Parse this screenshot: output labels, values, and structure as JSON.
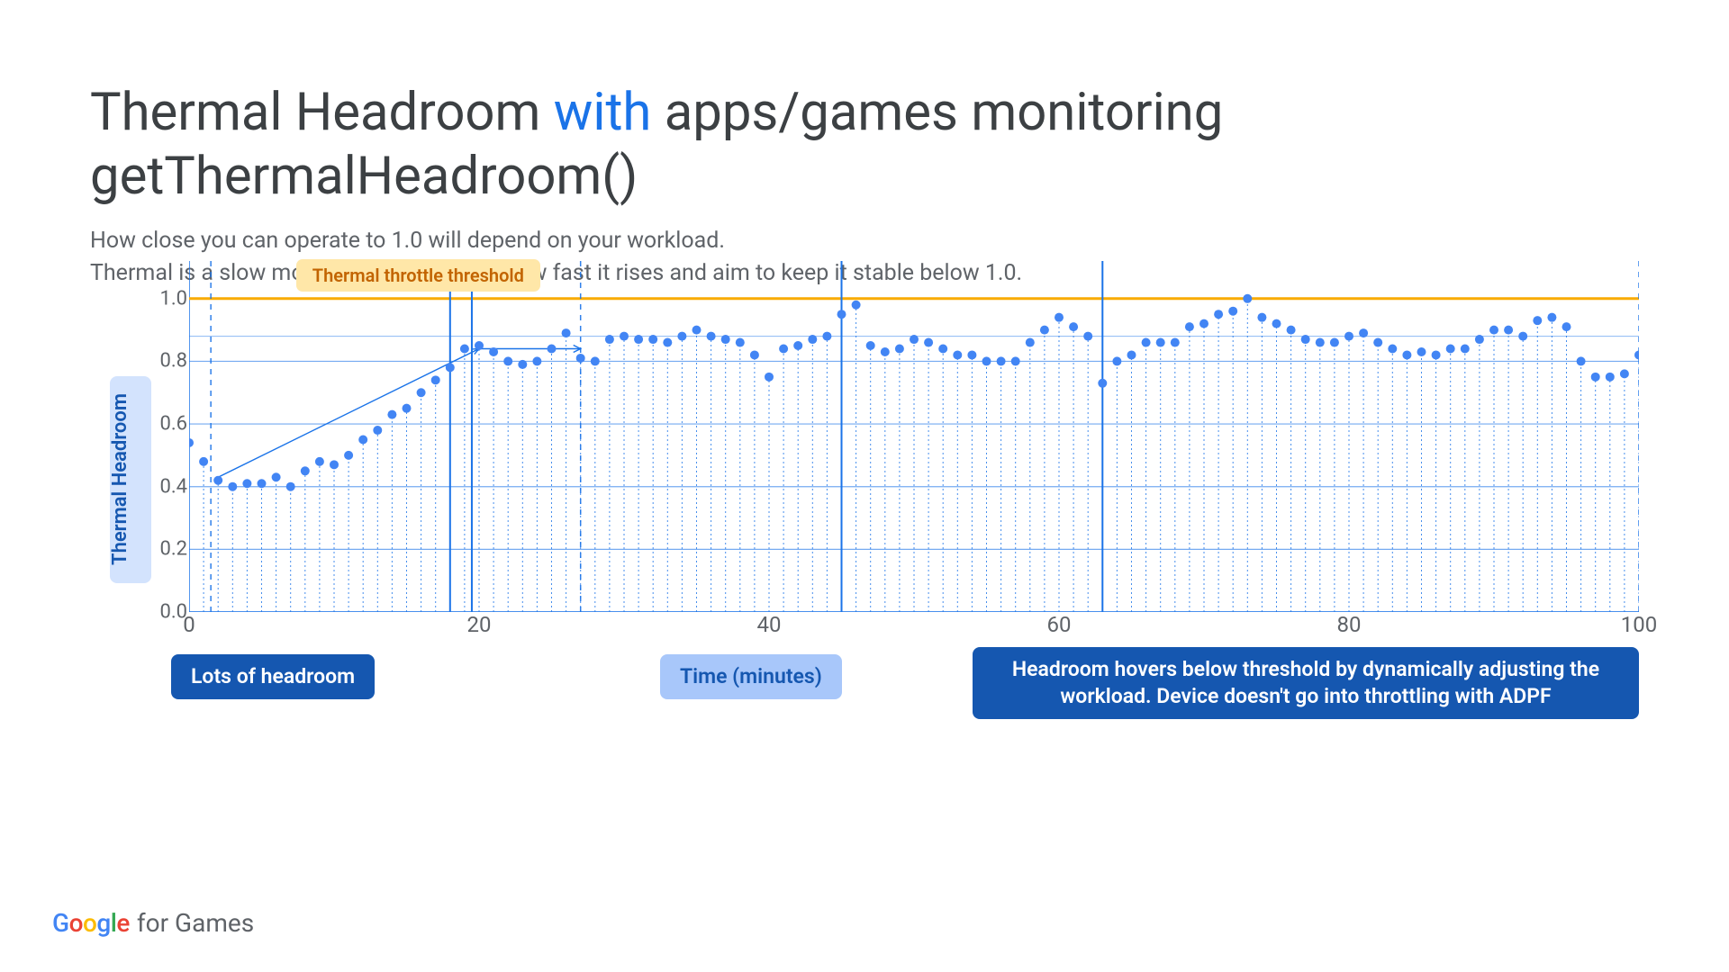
{
  "title_part1": "Thermal Headroom ",
  "title_accent": "with",
  "title_part2": " apps/games monitoring getThermalHeadroom()",
  "subtitle_line1": "How close you can operate to 1.0 will depend on your workload.",
  "subtitle_line2": "Thermal is a slow moving signal; monitor how fast it rises and aim to keep it stable below 1.0.",
  "ylabel": "Thermal Headroom",
  "threshold_label": "Thermal throttle threshold",
  "xlabel_pill": "Time (minutes)",
  "annotation_left": "Lots of headroom",
  "annotation_right": "Headroom hovers below threshold by dynamically adjusting the workload. Device doesn't go into throttling with ADPF",
  "brand_google": "Google",
  "brand_suffix": "for Games",
  "chart_data": {
    "type": "scatter",
    "title": "Thermal Headroom with apps/games monitoring getThermalHeadroom()",
    "xlabel": "Time (minutes)",
    "ylabel": "Thermal Headroom",
    "xlim": [
      0,
      100
    ],
    "ylim": [
      0.0,
      1.12
    ],
    "yticks": [
      0.0,
      0.2,
      0.4,
      0.6,
      0.8,
      1.0
    ],
    "xticks": [
      0,
      20,
      40,
      60,
      80,
      100
    ],
    "threshold": 1.0,
    "threshold_label": "Thermal throttle threshold",
    "vertical_divider_xs": [
      1.5,
      18,
      19.5,
      27,
      45,
      63,
      100
    ],
    "region_markers": [
      {
        "x": 1.5,
        "style": "dashed"
      },
      {
        "x": 18,
        "style": "solid"
      },
      {
        "x": 19.5,
        "style": "solid"
      },
      {
        "x": 27,
        "style": "dashed"
      },
      {
        "x": 45,
        "style": "solid"
      },
      {
        "x": 63,
        "style": "solid"
      },
      {
        "x": 100,
        "style": "dashed"
      }
    ],
    "annotations": [
      {
        "text": "Lots of headroom",
        "x_range": [
          1.5,
          18
        ]
      },
      {
        "text": "Headroom hovers below threshold by dynamically adjusting the workload. Device doesn't go into throttling with ADPF",
        "x_range": [
          27,
          100
        ]
      }
    ],
    "series": [
      {
        "name": "Thermal Headroom",
        "color": "#4285f4",
        "x": [
          0,
          1,
          2,
          3,
          4,
          5,
          6,
          7,
          8,
          9,
          10,
          11,
          12,
          13,
          14,
          15,
          16,
          17,
          18,
          19,
          20,
          21,
          22,
          23,
          24,
          25,
          26,
          27,
          28,
          29,
          30,
          31,
          32,
          33,
          34,
          35,
          36,
          37,
          38,
          39,
          40,
          41,
          42,
          43,
          44,
          45,
          46,
          47,
          48,
          49,
          50,
          51,
          52,
          53,
          54,
          55,
          56,
          57,
          58,
          59,
          60,
          61,
          62,
          63,
          64,
          65,
          66,
          67,
          68,
          69,
          70,
          71,
          72,
          73,
          74,
          75,
          76,
          77,
          78,
          79,
          80,
          81,
          82,
          83,
          84,
          85,
          86,
          87,
          88,
          89,
          90,
          91,
          92,
          93,
          94,
          95,
          96,
          97,
          98,
          99,
          100
        ],
        "y": [
          0.54,
          0.48,
          0.42,
          0.4,
          0.41,
          0.41,
          0.43,
          0.4,
          0.45,
          0.48,
          0.47,
          0.5,
          0.55,
          0.58,
          0.63,
          0.65,
          0.7,
          0.74,
          0.78,
          0.84,
          0.85,
          0.83,
          0.8,
          0.79,
          0.8,
          0.84,
          0.89,
          0.81,
          0.8,
          0.87,
          0.88,
          0.87,
          0.87,
          0.86,
          0.88,
          0.9,
          0.88,
          0.87,
          0.86,
          0.82,
          0.75,
          0.84,
          0.85,
          0.87,
          0.88,
          0.95,
          0.98,
          0.85,
          0.83,
          0.84,
          0.87,
          0.86,
          0.84,
          0.82,
          0.82,
          0.8,
          0.8,
          0.8,
          0.86,
          0.9,
          0.94,
          0.91,
          0.88,
          0.73,
          0.8,
          0.82,
          0.86,
          0.86,
          0.86,
          0.91,
          0.92,
          0.95,
          0.96,
          1.0,
          0.94,
          0.92,
          0.9,
          0.87,
          0.86,
          0.86,
          0.88,
          0.89,
          0.86,
          0.84,
          0.82,
          0.83,
          0.82,
          0.84,
          0.84,
          0.87,
          0.9,
          0.9,
          0.88,
          0.93,
          0.94,
          0.91,
          0.8,
          0.75,
          0.75,
          0.76,
          0.82
        ]
      }
    ]
  },
  "colors": {
    "blue": "#1a73e8",
    "blue_dark": "#1557b0",
    "blue_light": "#a8c7fa",
    "orange": "#f9ab00"
  }
}
